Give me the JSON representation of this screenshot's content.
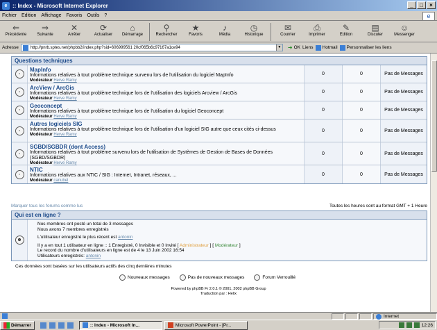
{
  "window": {
    "title": ":: Index - Microsoft Internet Explorer",
    "controls": [
      "_",
      "□",
      "×"
    ]
  },
  "menu": [
    "Fichier",
    "Edition",
    "Affichage",
    "Favoris",
    "Outils",
    "?"
  ],
  "toolbar": [
    {
      "label": "Précédente",
      "icon": "back-arrow-icon",
      "glyph": "⇐"
    },
    {
      "label": "Suivante",
      "icon": "forward-arrow-icon",
      "glyph": "⇒"
    },
    {
      "label": "Arrêter",
      "icon": "stop-icon",
      "glyph": "✕"
    },
    {
      "label": "Actualiser",
      "icon": "refresh-icon",
      "glyph": "⟳"
    },
    {
      "label": "Démarrage",
      "icon": "home-icon",
      "glyph": "⌂"
    },
    {
      "label": "Rechercher",
      "icon": "search-icon",
      "glyph": "⚲"
    },
    {
      "label": "Favoris",
      "icon": "favorites-icon",
      "glyph": "★"
    },
    {
      "label": "Média",
      "icon": "media-icon",
      "glyph": "♪"
    },
    {
      "label": "Historique",
      "icon": "history-icon",
      "glyph": "◷"
    },
    {
      "label": "Courrier",
      "icon": "mail-icon",
      "glyph": "✉"
    },
    {
      "label": "Imprimer",
      "icon": "print-icon",
      "glyph": "⎙"
    },
    {
      "label": "Edition",
      "icon": "edit-icon",
      "glyph": "✎"
    },
    {
      "label": "Discuter",
      "icon": "discuss-icon",
      "glyph": "▤"
    },
    {
      "label": "Messenger",
      "icon": "messenger-icon",
      "glyph": "☺"
    }
  ],
  "address": {
    "label": "Adresse",
    "url": "http://pnrb.sptes.net/phpbb2/index.php?sid=606999561 20cf065b6c97167a1ce94",
    "go": "OK",
    "links_label": "Liens",
    "links": [
      "Hotmail",
      "Personnaliser les liens"
    ]
  },
  "category": {
    "title": "Questions techniques",
    "moderator_label": "Modérateur",
    "forums": [
      {
        "name": "MapInfo",
        "desc": "Informations relatives à tout problème technique survenu lors de l'utilisation du logiciel MapInfo",
        "moderator": "Herve Ramy",
        "topics": "0",
        "posts": "0",
        "last": "Pas de Messages"
      },
      {
        "name": "ArcView / ArcGis",
        "desc": "Informations relatives à tout problème technique lors de l'utilisation des logiciels Arcview / ArcGis",
        "moderator": "Herve Ramy",
        "topics": "0",
        "posts": "0",
        "last": "Pas de Messages"
      },
      {
        "name": "Geoconcept",
        "desc": "Informations relatives à tout problème technique lors de l'utilisation du logiciel Geoconcept",
        "moderator": "Herve Ramy",
        "topics": "0",
        "posts": "0",
        "last": "Pas de Messages"
      },
      {
        "name": "Autres logiciels SIG",
        "desc": "Informations relatives à tout problème technique lors de l'utilisation d'un logiciel SIG autre que ceux cités ci-dessus",
        "moderator": "Herve Ramy",
        "topics": "0",
        "posts": "0",
        "last": "Pas de Messages"
      },
      {
        "name": "SGBD/SGBDR (dont Access)",
        "desc": "Informations relatives à tout problème survenu lors de l'utilisation de Systèmes de Gestion de Bases de Données (SGBD/SGBDR)",
        "moderator": "Herve Ramy",
        "topics": "0",
        "posts": "0",
        "last": "Pas de Messages"
      },
      {
        "name": "NTIC",
        "desc": "Informations relatives aux NTIC / SIG : Internet, Intranet, réseaux, ...",
        "moderator": "canubel",
        "topics": "0",
        "posts": "0",
        "last": "Pas de Messages"
      }
    ]
  },
  "footer_line": {
    "mark_read": "Marquer tous les forums comme lus",
    "timezone": "Toutes les heures sont au format GMT + 1 Heure"
  },
  "online": {
    "title": "Qui est en ligne ?",
    "lines": {
      "l1": "Nos membres ont posté un total de 3 messages",
      "l2": "Nous avons 7 membres enregistrés",
      "l3_prefix": "L'utilisateur enregistré le plus récent est ",
      "l3_user": "antonin",
      "l4_prefix": "Il y a en tout 1 utilisateur en ligne :: 1 Enregistré, 0 Invisible et 0 Invité   [ ",
      "admin": "Administrateur",
      "mid": " ]   [ ",
      "moderator": "Modérateur",
      "end": " ]",
      "l5": "Le record du nombre d'utilisateurs en ligne est de 4 le 13 Juin 2002 16:54",
      "l6_prefix": "Utilisateurs enregistrés: ",
      "l6_user": "antonin"
    },
    "footnote": "Ces données sont basées sur les utilisateurs actifs des cinq dernières minutes"
  },
  "legend": [
    "Nouveaux messages",
    "Pas de nouveaux messages",
    "Forum Verrouillé"
  ],
  "powered": {
    "line1": "Powered by phpBB Fr 2.0.1 © 2001, 2002 phpBB Group",
    "line2": "Traduction par : Helix"
  },
  "statusbar": {
    "zone": "Internet"
  },
  "taskbar": {
    "start": "Démarrer",
    "tasks": [
      ":: Index - Microsoft In...",
      "Microsoft PowerPoint - [Pr..."
    ],
    "clock": "12:26"
  }
}
